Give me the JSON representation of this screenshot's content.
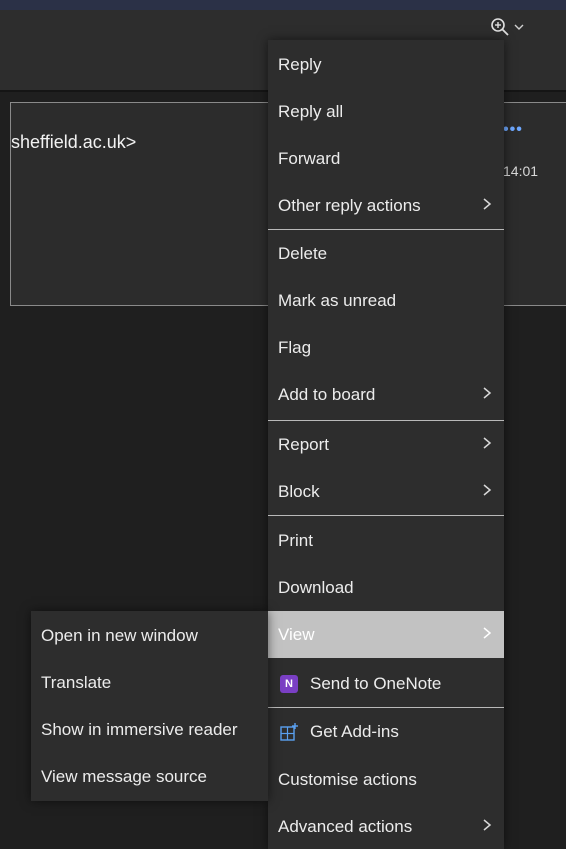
{
  "header": {
    "zoom_icon": "zoom-in-icon",
    "dropdown_icon": "chevron-down-icon"
  },
  "email": {
    "sender": "sheffield.ac.uk>",
    "more_icon": "•••",
    "time": "14:01"
  },
  "context_menu": {
    "items": [
      {
        "label": "Reply"
      },
      {
        "label": "Reply all"
      },
      {
        "label": "Forward"
      },
      {
        "label": "Other reply actions",
        "submenu": true
      },
      {
        "label": "Delete"
      },
      {
        "label": "Mark as unread"
      },
      {
        "label": "Flag"
      },
      {
        "label": "Add to board",
        "submenu": true
      },
      {
        "label": "Report",
        "submenu": true
      },
      {
        "label": "Block",
        "submenu": true
      },
      {
        "label": "Print"
      },
      {
        "label": "Download"
      },
      {
        "label": "View",
        "submenu": true,
        "active": true
      },
      {
        "label": "Send to OneNote",
        "icon": "onenote-icon"
      },
      {
        "label": "Get Add-ins",
        "icon": "add-ins-icon"
      },
      {
        "label": "Customise actions"
      },
      {
        "label": "Advanced actions",
        "submenu": true
      }
    ],
    "onenote_glyph": "N"
  },
  "view_submenu": {
    "items": [
      {
        "label": "Open in new window"
      },
      {
        "label": "Translate"
      },
      {
        "label": "Show in immersive reader"
      },
      {
        "label": "View message source"
      }
    ]
  },
  "colors": {
    "menu_bg": "#2d2d2d",
    "active_bg": "#c2c2c2",
    "accent": "#6ea8ff",
    "onenote": "#7a3fc4"
  }
}
